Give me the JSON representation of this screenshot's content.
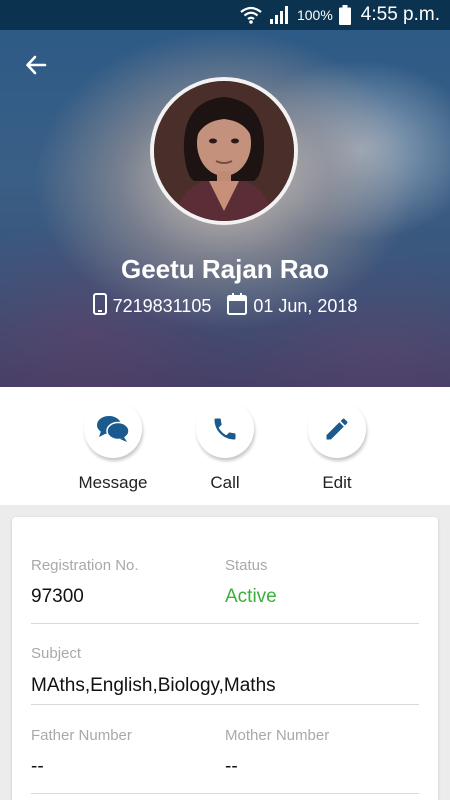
{
  "status_bar": {
    "battery": "100%",
    "time": "4:55 p.m."
  },
  "profile": {
    "name": "Geetu Rajan Rao",
    "phone": "7219831105",
    "date": "01 Jun, 2018"
  },
  "actions": [
    {
      "label": "Message"
    },
    {
      "label": "Call"
    },
    {
      "label": "Edit"
    }
  ],
  "details": {
    "registration_label": "Registration No.",
    "registration_value": "97300",
    "status_label": "Status",
    "status_value": "Active",
    "subject_label": "Subject",
    "subject_value": "MAths,English,Biology,Maths",
    "father_label": "Father Number",
    "father_value": "--",
    "mother_label": "Mother Number",
    "mother_value": "--"
  },
  "colors": {
    "status_bar": "#0b3350",
    "accent_blue": "#1a5a8f",
    "active_green": "#3cae3c"
  }
}
